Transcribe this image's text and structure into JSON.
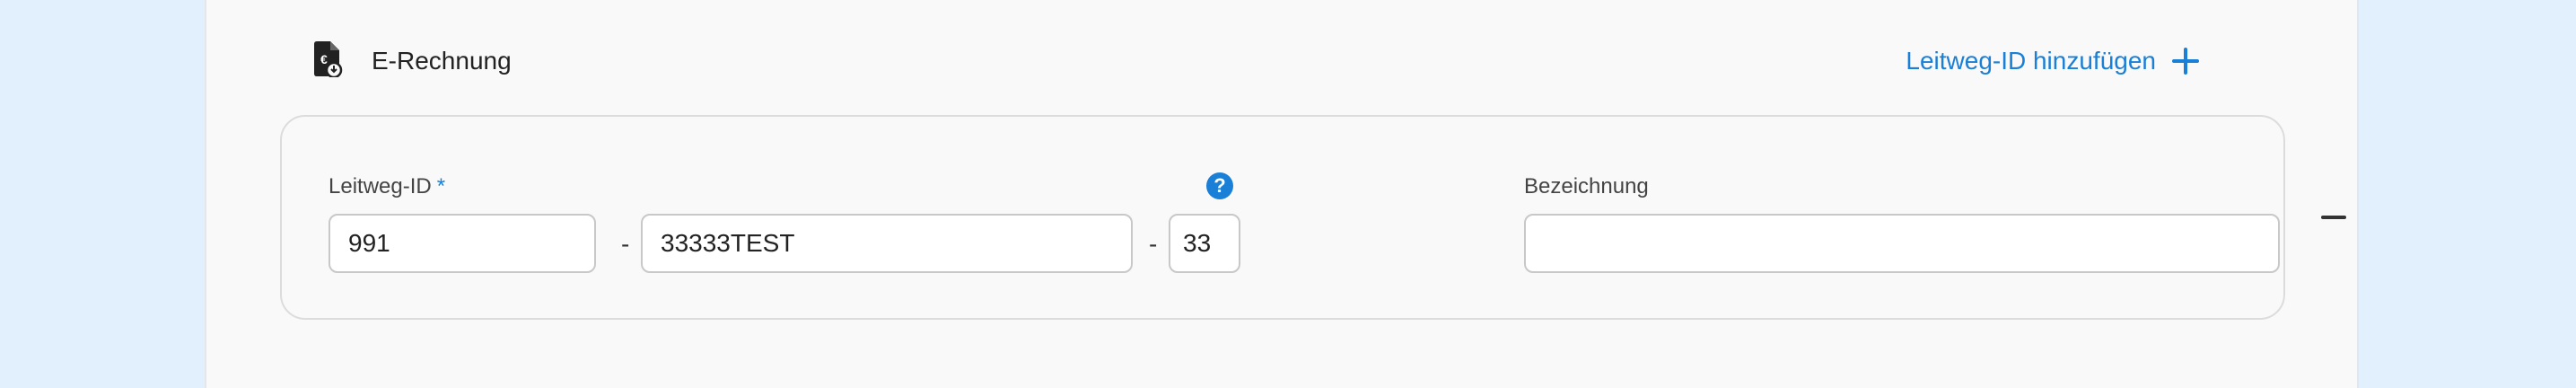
{
  "section": {
    "title": "E-Rechnung",
    "icon": "document-euro-icon",
    "add_link_label": "Leitweg-ID hinzufügen",
    "add_icon": "plus-icon"
  },
  "leitweg": {
    "label": "Leitweg-ID",
    "required_mark": "*",
    "help_glyph": "?",
    "separator": "-",
    "part1": "991",
    "part2": "33333TEST",
    "part3": "33"
  },
  "bezeichnung": {
    "label": "Bezeichnung",
    "value": ""
  },
  "colors": {
    "accent": "#1a7fd6",
    "page_bg": "#e2f0fd",
    "panel_bg": "#f9f9f9"
  }
}
